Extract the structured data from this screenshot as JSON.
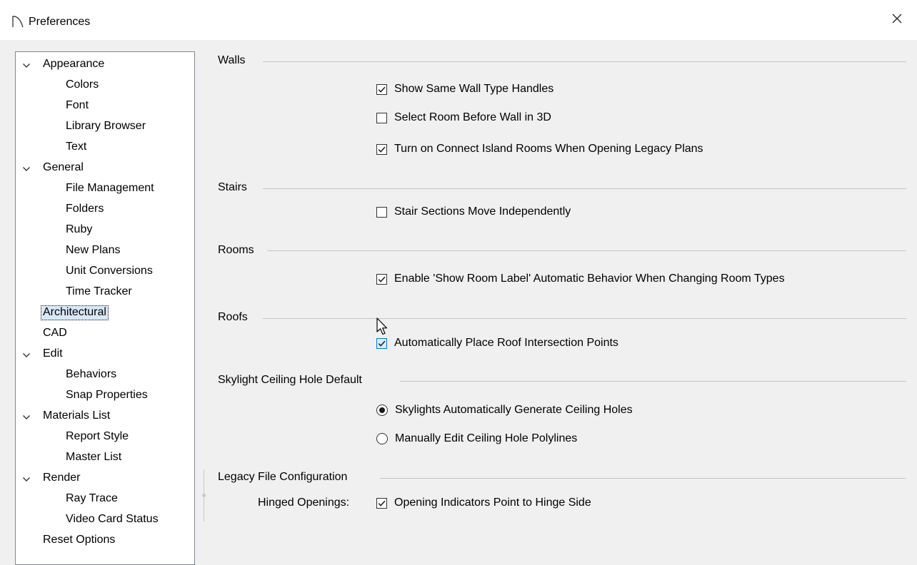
{
  "window": {
    "title": "Preferences"
  },
  "tree": [
    {
      "label": "Appearance",
      "level": 0,
      "expanded": true,
      "name": "appearance"
    },
    {
      "label": "Colors",
      "level": 1,
      "name": "colors"
    },
    {
      "label": "Font",
      "level": 1,
      "name": "font"
    },
    {
      "label": "Library Browser",
      "level": 1,
      "name": "library-browser"
    },
    {
      "label": "Text",
      "level": 1,
      "name": "text"
    },
    {
      "label": "General",
      "level": 0,
      "expanded": true,
      "name": "general"
    },
    {
      "label": "File Management",
      "level": 1,
      "name": "file-management"
    },
    {
      "label": "Folders",
      "level": 1,
      "name": "folders"
    },
    {
      "label": "Ruby",
      "level": 1,
      "name": "ruby"
    },
    {
      "label": "New Plans",
      "level": 1,
      "name": "new-plans"
    },
    {
      "label": "Unit Conversions",
      "level": 1,
      "name": "unit-conversions"
    },
    {
      "label": "Time Tracker",
      "level": 1,
      "name": "time-tracker"
    },
    {
      "label": "Architectural",
      "level": 0,
      "selected": true,
      "name": "architectural"
    },
    {
      "label": "CAD",
      "level": 0,
      "name": "cad"
    },
    {
      "label": "Edit",
      "level": 0,
      "expanded": true,
      "name": "edit"
    },
    {
      "label": "Behaviors",
      "level": 1,
      "name": "behaviors"
    },
    {
      "label": "Snap Properties",
      "level": 1,
      "name": "snap-properties"
    },
    {
      "label": "Materials List",
      "level": 0,
      "expanded": true,
      "name": "materials-list"
    },
    {
      "label": "Report Style",
      "level": 1,
      "name": "report-style"
    },
    {
      "label": "Master List",
      "level": 1,
      "name": "master-list"
    },
    {
      "label": "Render",
      "level": 0,
      "expanded": true,
      "name": "render"
    },
    {
      "label": "Ray Trace",
      "level": 1,
      "name": "ray-trace"
    },
    {
      "label": "Video Card Status",
      "level": 1,
      "name": "video-card-status"
    },
    {
      "label": "Reset Options",
      "level": 0,
      "name": "reset-options"
    }
  ],
  "groups": {
    "walls": {
      "title": "Walls",
      "options": [
        {
          "label": "Show Same Wall Type Handles",
          "checked": true
        },
        {
          "label": "Select Room Before Wall in 3D",
          "checked": false
        },
        {
          "label": "Turn on Connect Island Rooms When Opening Legacy Plans",
          "checked": true
        }
      ]
    },
    "stairs": {
      "title": "Stairs",
      "options": [
        {
          "label": "Stair Sections Move Independently",
          "checked": false
        }
      ]
    },
    "rooms": {
      "title": "Rooms",
      "options": [
        {
          "label": "Enable 'Show Room Label' Automatic Behavior When Changing Room Types",
          "checked": true
        }
      ]
    },
    "roofs": {
      "title": "Roofs",
      "options": [
        {
          "label": "Automatically Place Roof Intersection Points",
          "checked": true
        }
      ]
    },
    "skylight": {
      "title": "Skylight Ceiling Hole Default",
      "options": [
        {
          "label": "Skylights Automatically Generate Ceiling Holes",
          "selected": true
        },
        {
          "label": "Manually Edit Ceiling Hole Polylines",
          "selected": false
        }
      ]
    },
    "legacy": {
      "title": "Legacy File Configuration",
      "field_label": "Hinged Openings:",
      "options": [
        {
          "label": "Opening Indicators Point to Hinge Side",
          "checked": true
        }
      ]
    }
  },
  "icons": {
    "app": "app-arc-icon",
    "close": "close-icon",
    "expand": "chevron-down-icon",
    "cursor": "mouse-pointer-icon"
  },
  "colors": {
    "selection_bg": "#d9e8f8",
    "checkbox_hover_border": "#0078d7"
  }
}
